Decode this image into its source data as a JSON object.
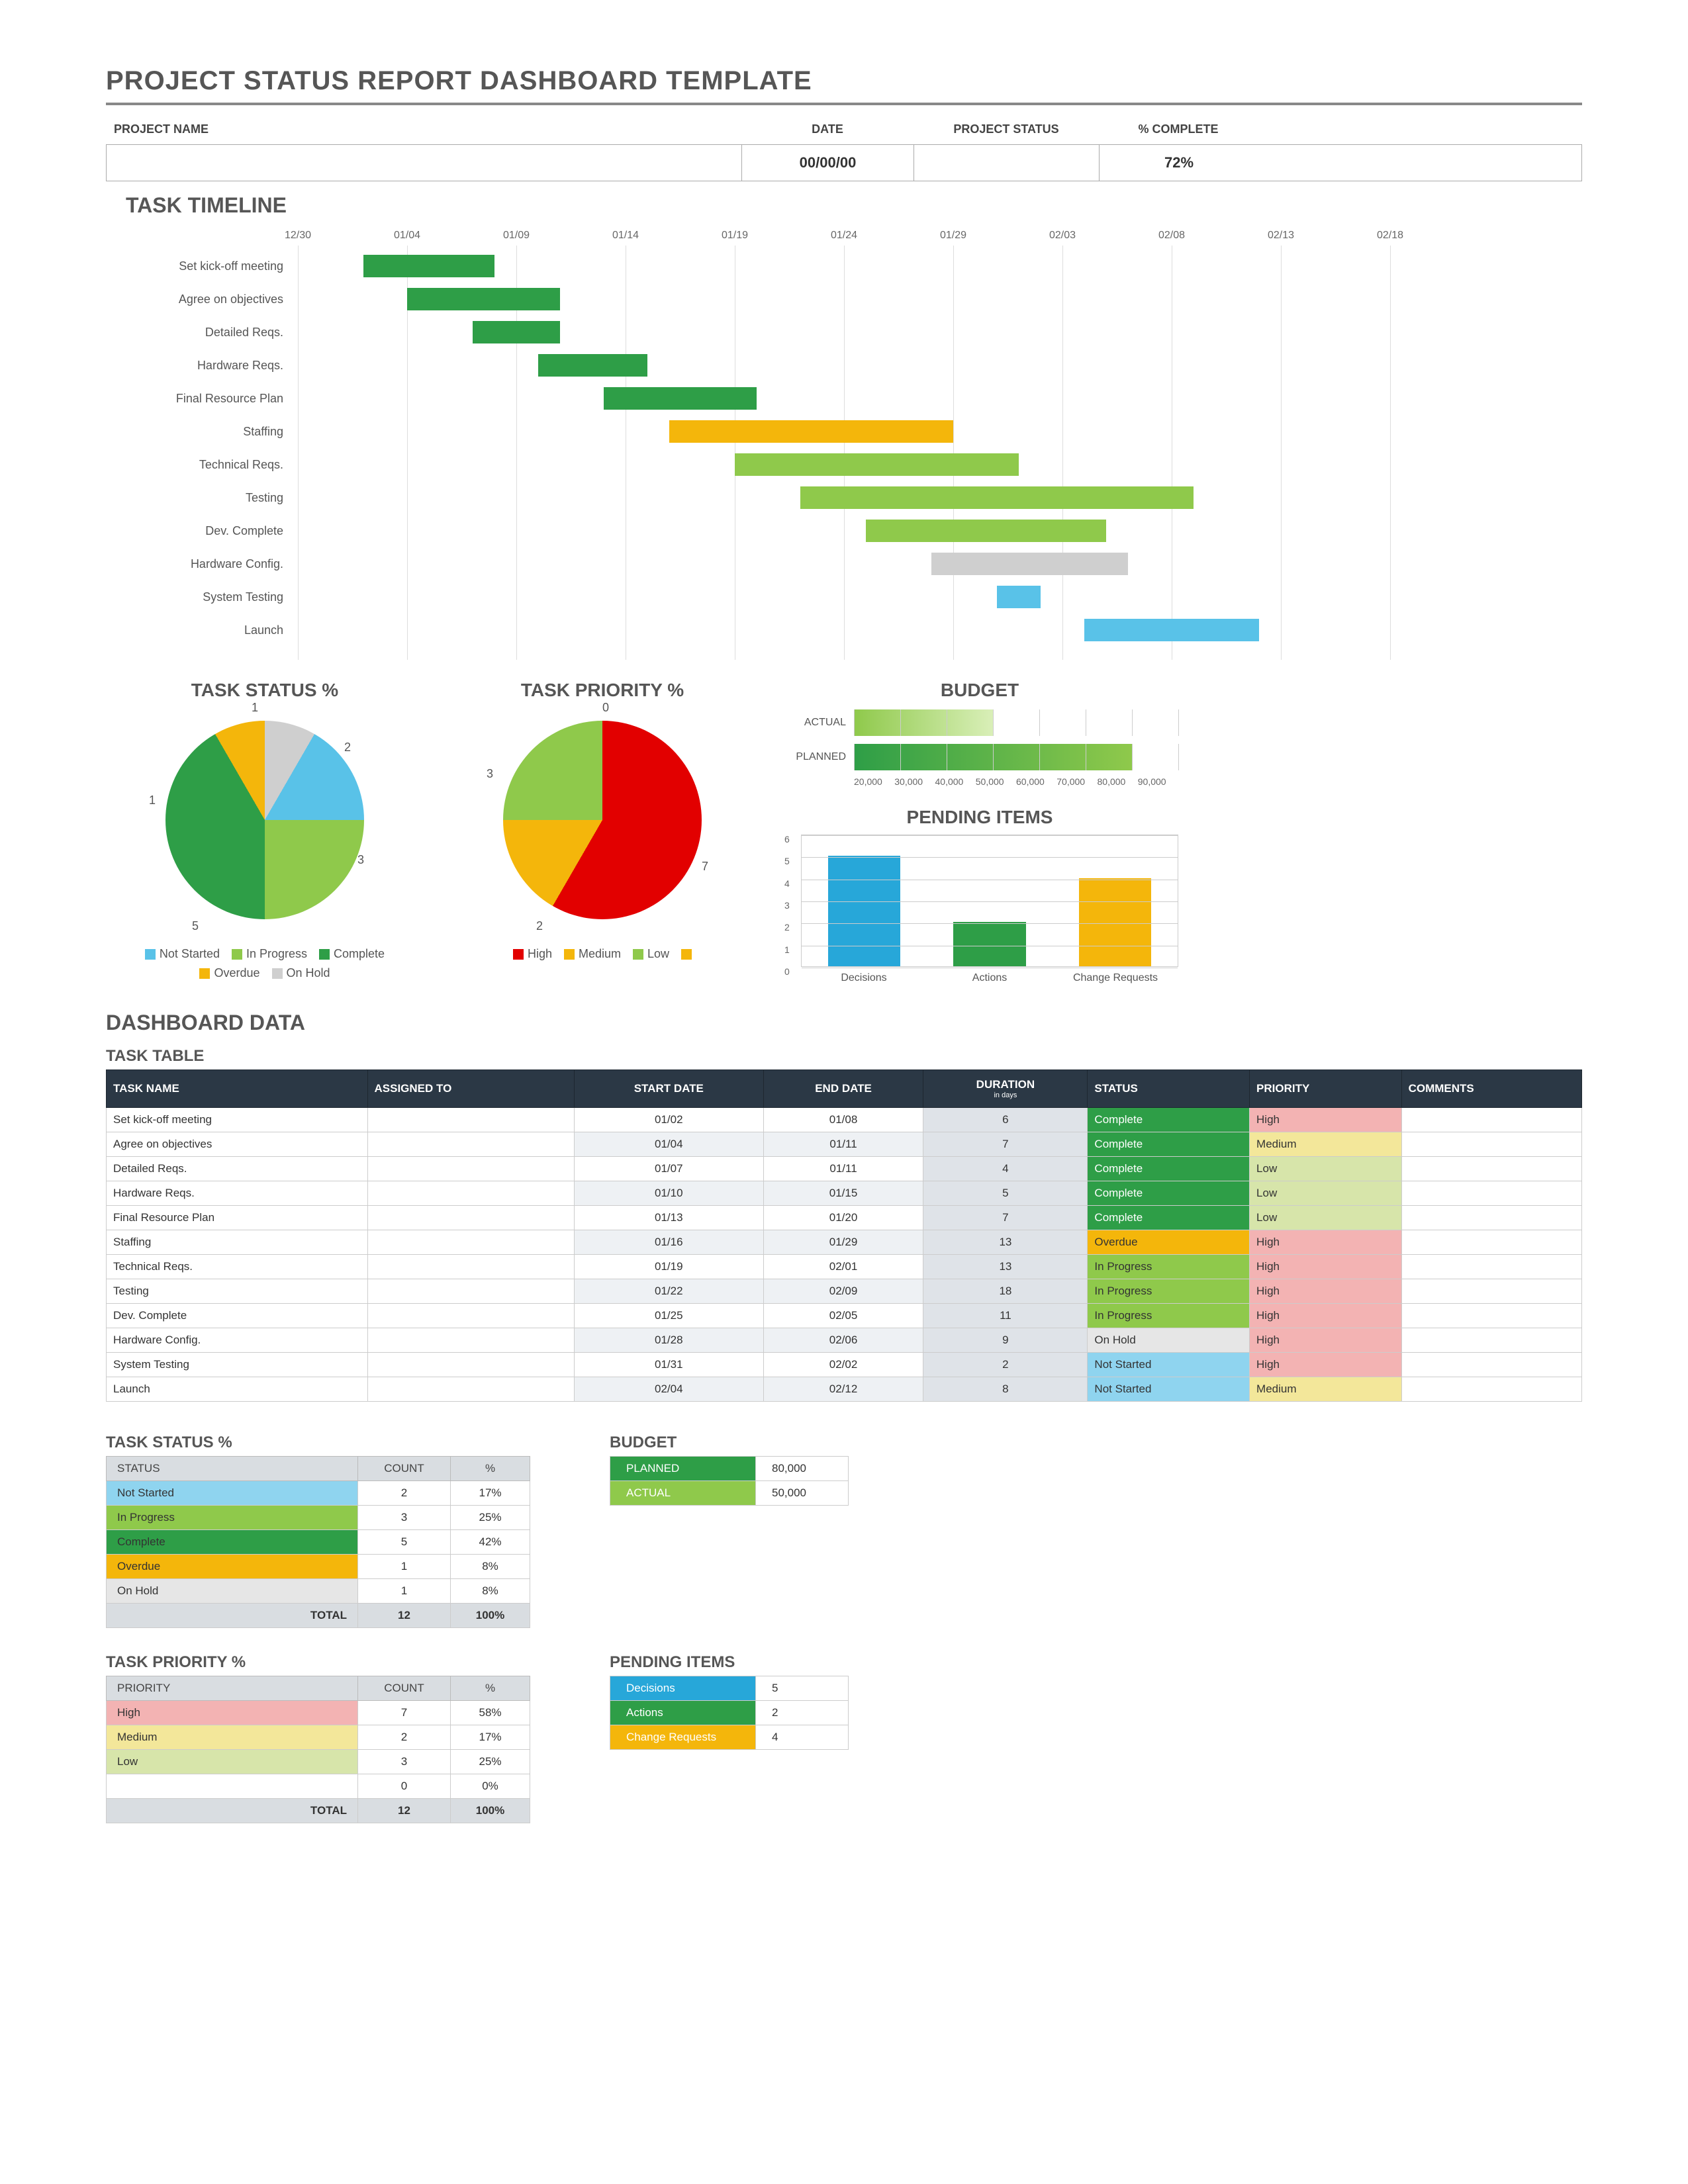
{
  "title": "PROJECT STATUS REPORT DASHBOARD TEMPLATE",
  "header": {
    "projectNameLabel": "PROJECT NAME",
    "dateLabel": "DATE",
    "statusLabel": "PROJECT STATUS",
    "completeLabel": "% COMPLETE",
    "projectName": "",
    "date": "00/00/00",
    "status": "",
    "complete": "72%"
  },
  "sections": {
    "taskTimeline": "TASK TIMELINE",
    "taskStatus": "TASK STATUS %",
    "taskPriority": "TASK PRIORITY %",
    "budget": "BUDGET",
    "pending": "PENDING ITEMS",
    "dashboardData": "DASHBOARD DATA",
    "taskTable": "TASK TABLE"
  },
  "gantt": {
    "dates": [
      "12/30",
      "01/04",
      "01/09",
      "01/14",
      "01/19",
      "01/24",
      "01/29",
      "02/03",
      "02/08",
      "02/13",
      "02/18"
    ],
    "tasks": [
      {
        "name": "Set kick-off meeting",
        "start": 3,
        "dur": 6,
        "cls": "c-complete"
      },
      {
        "name": "Agree on objectives",
        "start": 5,
        "dur": 7,
        "cls": "c-complete"
      },
      {
        "name": "Detailed Reqs.",
        "start": 8,
        "dur": 4,
        "cls": "c-complete"
      },
      {
        "name": "Hardware Reqs.",
        "start": 11,
        "dur": 5,
        "cls": "c-complete"
      },
      {
        "name": "Final Resource Plan",
        "start": 14,
        "dur": 7,
        "cls": "c-complete"
      },
      {
        "name": "Staffing",
        "start": 17,
        "dur": 13,
        "cls": "c-overdue"
      },
      {
        "name": "Technical Reqs.",
        "start": 20,
        "dur": 13,
        "cls": "c-progress"
      },
      {
        "name": "Testing",
        "start": 23,
        "dur": 18,
        "cls": "c-progress"
      },
      {
        "name": "Dev. Complete",
        "start": 26,
        "dur": 11,
        "cls": "c-progress"
      },
      {
        "name": "Hardware Config.",
        "start": 29,
        "dur": 9,
        "cls": "c-hold"
      },
      {
        "name": "System Testing",
        "start": 32,
        "dur": 2,
        "cls": "c-notstarted"
      },
      {
        "name": "Launch",
        "start": 36,
        "dur": 8,
        "cls": "c-notstarted"
      }
    ]
  },
  "statusPie": {
    "legend": [
      {
        "label": "Not Started",
        "cls": "c-notstarted"
      },
      {
        "label": "In Progress",
        "cls": "c-progress"
      },
      {
        "label": "Complete",
        "cls": "c-complete"
      },
      {
        "label": "Overdue",
        "cls": "c-overdue"
      },
      {
        "label": "On Hold",
        "cls": "c-hold"
      }
    ],
    "labels": [
      "1",
      "2",
      "3",
      "5",
      "1"
    ]
  },
  "priorityPie": {
    "legend": [
      {
        "label": "High",
        "cls": "c-high"
      },
      {
        "label": "Medium",
        "cls": "c-medium"
      },
      {
        "label": "Low",
        "cls": "c-low"
      },
      {
        "label": "",
        "cls": "c-overdue"
      }
    ],
    "labels": [
      "0",
      "7",
      "2",
      "3"
    ]
  },
  "budgetChart": {
    "rows": [
      {
        "label": "ACTUAL",
        "value": 50000
      },
      {
        "label": "PLANNED",
        "value": 80000
      }
    ],
    "ticks": [
      "20,000",
      "30,000",
      "40,000",
      "50,000",
      "60,000",
      "70,000",
      "80,000",
      "90,000"
    ]
  },
  "pendingChart": {
    "ymax": 6,
    "ticks": [
      "0",
      "1",
      "2",
      "3",
      "4",
      "5",
      "6"
    ],
    "bars": [
      {
        "label": "Decisions",
        "value": 5,
        "color": "#27a7d9"
      },
      {
        "label": "Actions",
        "value": 2,
        "color": "#2e9e47"
      },
      {
        "label": "Change Requests",
        "value": 4,
        "color": "#f4b60b"
      }
    ]
  },
  "taskTable": {
    "headers": [
      "TASK NAME",
      "ASSIGNED TO",
      "START DATE",
      "END DATE",
      "DURATION",
      "STATUS",
      "PRIORITY",
      "COMMENTS"
    ],
    "durationSub": "in days",
    "rows": [
      {
        "name": "Set kick-off meeting",
        "assigned": "",
        "start": "01/02",
        "end": "01/08",
        "dur": "6",
        "status": "Complete",
        "sCls": "cell-complete",
        "priority": "High",
        "pCls": "cell-high",
        "comments": ""
      },
      {
        "name": "Agree on objectives",
        "assigned": "",
        "start": "01/04",
        "end": "01/11",
        "dur": "7",
        "status": "Complete",
        "sCls": "cell-complete",
        "priority": "Medium",
        "pCls": "cell-medium",
        "comments": ""
      },
      {
        "name": "Detailed Reqs.",
        "assigned": "",
        "start": "01/07",
        "end": "01/11",
        "dur": "4",
        "status": "Complete",
        "sCls": "cell-complete",
        "priority": "Low",
        "pCls": "cell-low",
        "comments": ""
      },
      {
        "name": "Hardware Reqs.",
        "assigned": "",
        "start": "01/10",
        "end": "01/15",
        "dur": "5",
        "status": "Complete",
        "sCls": "cell-complete",
        "priority": "Low",
        "pCls": "cell-low",
        "comments": ""
      },
      {
        "name": "Final Resource Plan",
        "assigned": "",
        "start": "01/13",
        "end": "01/20",
        "dur": "7",
        "status": "Complete",
        "sCls": "cell-complete",
        "priority": "Low",
        "pCls": "cell-low",
        "comments": ""
      },
      {
        "name": "Staffing",
        "assigned": "",
        "start": "01/16",
        "end": "01/29",
        "dur": "13",
        "status": "Overdue",
        "sCls": "cell-overdue",
        "priority": "High",
        "pCls": "cell-high",
        "comments": ""
      },
      {
        "name": "Technical Reqs.",
        "assigned": "",
        "start": "01/19",
        "end": "02/01",
        "dur": "13",
        "status": "In Progress",
        "sCls": "cell-progress",
        "priority": "High",
        "pCls": "cell-high",
        "comments": ""
      },
      {
        "name": "Testing",
        "assigned": "",
        "start": "01/22",
        "end": "02/09",
        "dur": "18",
        "status": "In Progress",
        "sCls": "cell-progress",
        "priority": "High",
        "pCls": "cell-high",
        "comments": ""
      },
      {
        "name": "Dev. Complete",
        "assigned": "",
        "start": "01/25",
        "end": "02/05",
        "dur": "11",
        "status": "In Progress",
        "sCls": "cell-progress",
        "priority": "High",
        "pCls": "cell-high",
        "comments": ""
      },
      {
        "name": "Hardware Config.",
        "assigned": "",
        "start": "01/28",
        "end": "02/06",
        "dur": "9",
        "status": "On Hold",
        "sCls": "cell-hold",
        "priority": "High",
        "pCls": "cell-high",
        "comments": ""
      },
      {
        "name": "System Testing",
        "assigned": "",
        "start": "01/31",
        "end": "02/02",
        "dur": "2",
        "status": "Not Started",
        "sCls": "cell-notstarted",
        "priority": "High",
        "pCls": "cell-high",
        "comments": ""
      },
      {
        "name": "Launch",
        "assigned": "",
        "start": "02/04",
        "end": "02/12",
        "dur": "8",
        "status": "Not Started",
        "sCls": "cell-notstarted",
        "priority": "Medium",
        "pCls": "cell-medium",
        "comments": ""
      }
    ]
  },
  "statusSummary": {
    "headers": [
      "STATUS",
      "COUNT",
      "%"
    ],
    "rows": [
      {
        "label": "Not Started",
        "count": "2",
        "pct": "17%",
        "bg": "#8fd4ef"
      },
      {
        "label": "In Progress",
        "count": "3",
        "pct": "25%",
        "bg": "#8fc94b"
      },
      {
        "label": "Complete",
        "count": "5",
        "pct": "42%",
        "bg": "#2e9e47"
      },
      {
        "label": "Overdue",
        "count": "1",
        "pct": "8%",
        "bg": "#f4b60b"
      },
      {
        "label": "On Hold",
        "count": "1",
        "pct": "8%",
        "bg": "#e6e6e6"
      }
    ],
    "totalLabel": "TOTAL",
    "totalCount": "12",
    "totalPct": "100%"
  },
  "prioritySummary": {
    "headers": [
      "PRIORITY",
      "COUNT",
      "%"
    ],
    "rows": [
      {
        "label": "High",
        "count": "7",
        "pct": "58%",
        "bg": "#f3b3b3"
      },
      {
        "label": "Medium",
        "count": "2",
        "pct": "17%",
        "bg": "#f3e79a"
      },
      {
        "label": "Low",
        "count": "3",
        "pct": "25%",
        "bg": "#d7e5aa"
      },
      {
        "label": "",
        "count": "0",
        "pct": "0%",
        "bg": "#fff"
      }
    ],
    "totalLabel": "TOTAL",
    "totalCount": "12",
    "totalPct": "100%"
  },
  "budgetSummary": {
    "rows": [
      {
        "label": "PLANNED",
        "value": "80,000",
        "bg": "#2e9e47"
      },
      {
        "label": "ACTUAL",
        "value": "50,000",
        "bg": "#8fc94b"
      }
    ]
  },
  "pendingSummary": {
    "rows": [
      {
        "label": "Decisions",
        "value": "5",
        "bg": "#27a7d9"
      },
      {
        "label": "Actions",
        "value": "2",
        "bg": "#2e9e47"
      },
      {
        "label": "Change Requests",
        "value": "4",
        "bg": "#f4b60b"
      }
    ]
  },
  "chart_data": [
    {
      "type": "gantt_bar",
      "title": "TASK TIMELINE",
      "x_ticks": [
        "12/30",
        "01/04",
        "01/09",
        "01/14",
        "01/19",
        "01/24",
        "01/29",
        "02/03",
        "02/08",
        "02/13",
        "02/18"
      ],
      "tasks": [
        {
          "name": "Set kick-off meeting",
          "start": "01/02",
          "end": "01/08",
          "status": "Complete"
        },
        {
          "name": "Agree on objectives",
          "start": "01/04",
          "end": "01/11",
          "status": "Complete"
        },
        {
          "name": "Detailed Reqs.",
          "start": "01/07",
          "end": "01/11",
          "status": "Complete"
        },
        {
          "name": "Hardware Reqs.",
          "start": "01/10",
          "end": "01/15",
          "status": "Complete"
        },
        {
          "name": "Final Resource Plan",
          "start": "01/13",
          "end": "01/20",
          "status": "Complete"
        },
        {
          "name": "Staffing",
          "start": "01/16",
          "end": "01/29",
          "status": "Overdue"
        },
        {
          "name": "Technical Reqs.",
          "start": "01/19",
          "end": "02/01",
          "status": "In Progress"
        },
        {
          "name": "Testing",
          "start": "01/22",
          "end": "02/09",
          "status": "In Progress"
        },
        {
          "name": "Dev. Complete",
          "start": "01/25",
          "end": "02/05",
          "status": "In Progress"
        },
        {
          "name": "Hardware Config.",
          "start": "01/28",
          "end": "02/06",
          "status": "On Hold"
        },
        {
          "name": "System Testing",
          "start": "01/31",
          "end": "02/02",
          "status": "Not Started"
        },
        {
          "name": "Launch",
          "start": "02/04",
          "end": "02/12",
          "status": "Not Started"
        }
      ]
    },
    {
      "type": "pie",
      "title": "TASK STATUS %",
      "categories": [
        "Not Started",
        "In Progress",
        "Complete",
        "Overdue",
        "On Hold"
      ],
      "values": [
        2,
        3,
        5,
        1,
        1
      ]
    },
    {
      "type": "pie",
      "title": "TASK PRIORITY %",
      "categories": [
        "High",
        "Medium",
        "Low",
        ""
      ],
      "values": [
        7,
        2,
        3,
        0
      ]
    },
    {
      "type": "bar",
      "title": "BUDGET",
      "orientation": "horizontal",
      "categories": [
        "ACTUAL",
        "PLANNED"
      ],
      "values": [
        50000,
        80000
      ],
      "xlim": [
        20000,
        90000
      ]
    },
    {
      "type": "bar",
      "title": "PENDING ITEMS",
      "categories": [
        "Decisions",
        "Actions",
        "Change Requests"
      ],
      "values": [
        5,
        2,
        4
      ],
      "ylim": [
        0,
        6
      ]
    }
  ]
}
